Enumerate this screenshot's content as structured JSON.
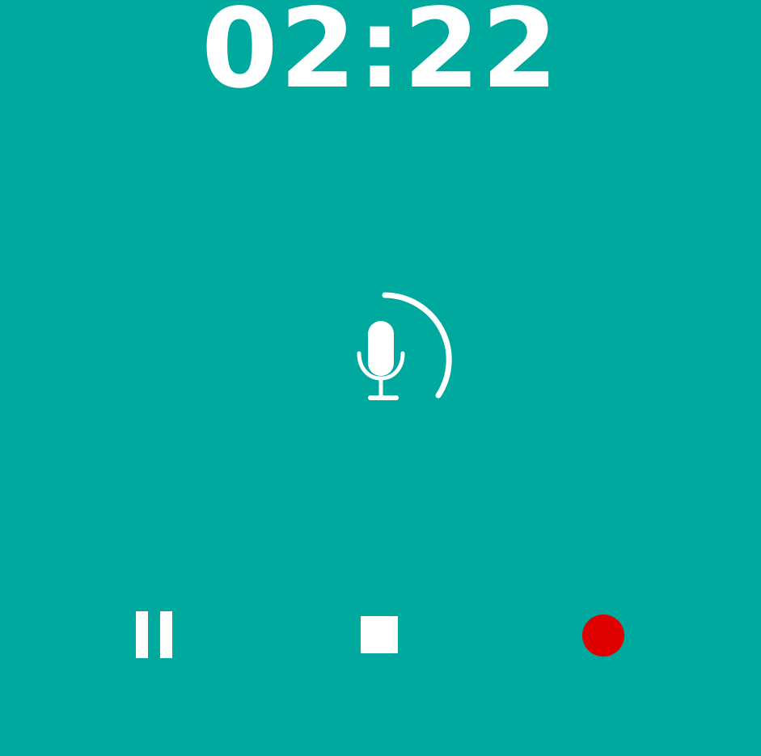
{
  "recorder": {
    "elapsed_time": "02:22",
    "status_icon": "microphone-icon",
    "level_indicator": "arc-indicator"
  },
  "controls": {
    "pause_icon": "pause-icon",
    "stop_icon": "stop-icon",
    "record_icon": "record-icon"
  },
  "colors": {
    "background": "#00A99D",
    "foreground": "#FFFFFF",
    "record": "#E00000"
  }
}
